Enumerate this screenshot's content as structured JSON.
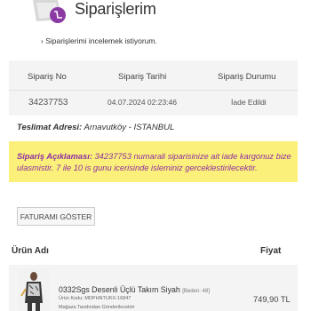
{
  "page": {
    "title": "Siparişlerim",
    "review_link": "› Siparişlerimi incelemek istiyorum."
  },
  "order_table": {
    "headers": [
      "Sipariş No",
      "Sipariş Tarihi",
      "Sipariş Durumu"
    ],
    "row": [
      "34237753",
      "04.07.2024 02:23:46",
      "İade Edildi"
    ]
  },
  "delivery": {
    "label": "Teslimat Adresi:",
    "value": "Arnavutköy - ISTANBUL"
  },
  "notice": {
    "label": "Sipariş Açıklaması:",
    "text": "34237753 numarali siparisinize ait iade kargonuz bize ulasmistir. 7 ile 10 is gunu icerisinde isleminiz gerceklestirilecektir."
  },
  "actions": {
    "invoice_button": "FATURAMI GÖSTER"
  },
  "items_table": {
    "col_product": "Ürün Adı",
    "col_price": "Fiyat",
    "items": [
      {
        "name": "0332Sgs Desenli Üçlü Takım Siyah",
        "size": "[Beden: 48]",
        "code": "Ürün Kodu: MDPHNTUKX-16847",
        "shipping": "Mağaza Tarafından Gönderilecektir",
        "price": "749,90 TL"
      }
    ]
  },
  "colors": {
    "notice_bg": "#fbf07a",
    "notice_text": "#8e2fa0",
    "panel_bg": "#f4f4f4"
  },
  "icons": {
    "logo": "shopping-bag-icon"
  }
}
